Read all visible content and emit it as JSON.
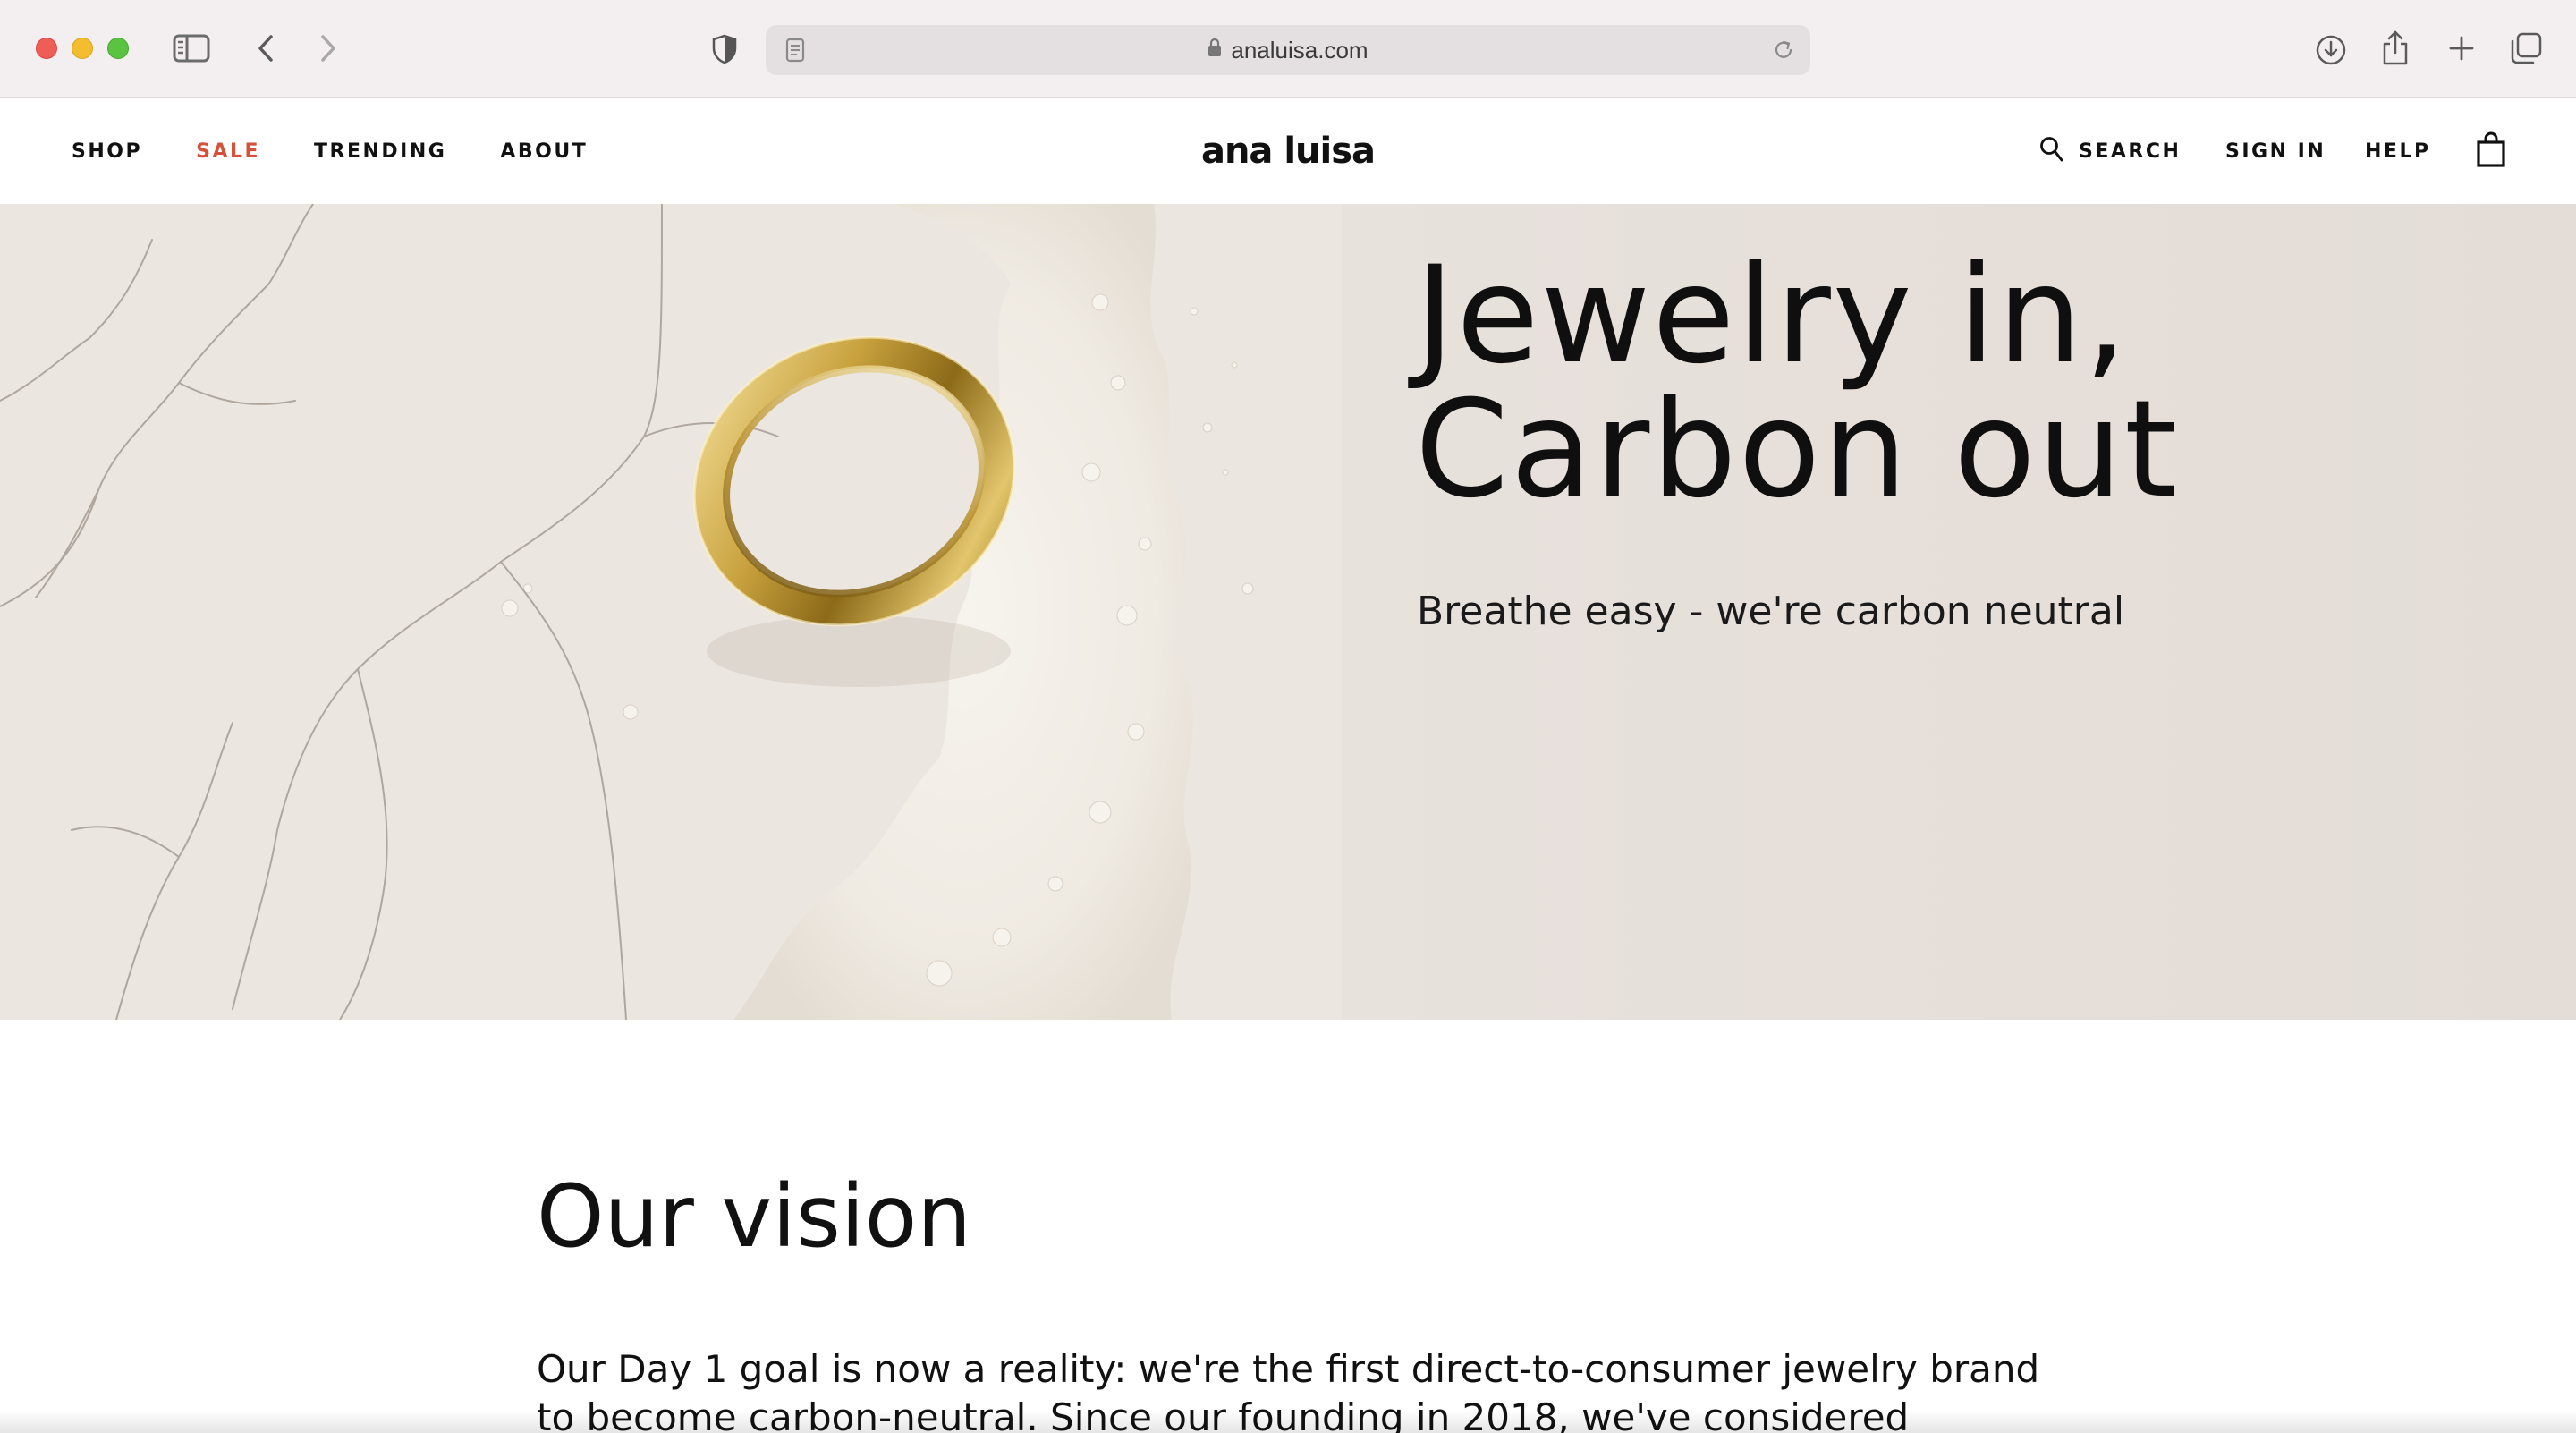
{
  "browser": {
    "url": "analuisa.com",
    "icons": {
      "sidebar": "sidebar-icon",
      "back": "chevron-left-icon",
      "forward": "chevron-right-icon",
      "privacy": "shield-icon",
      "reader": "reader-icon",
      "lock": "lock-icon",
      "reload": "reload-icon",
      "downloads": "download-icon",
      "share": "share-icon",
      "new_tab": "plus-icon",
      "tabs": "tab-overview-icon"
    }
  },
  "header": {
    "nav_left": [
      "SHOP",
      "SALE",
      "TRENDING",
      "ABOUT"
    ],
    "brand": "ana luisa",
    "search_label": "SEARCH",
    "signin_label": "SIGN IN",
    "help_label": "HELP",
    "sale_color": "#d4513b"
  },
  "hero": {
    "title_line1": "Jewelry in,",
    "title_line2": "Carbon out",
    "subtitle": "Breathe easy - we're carbon neutral"
  },
  "vision": {
    "title": "Our vision",
    "text": "Our Day 1 goal is now a reality: we're the first direct-to-consumer jewelry brand to become carbon-neutral. Since our founding in 2018, we've considered"
  }
}
